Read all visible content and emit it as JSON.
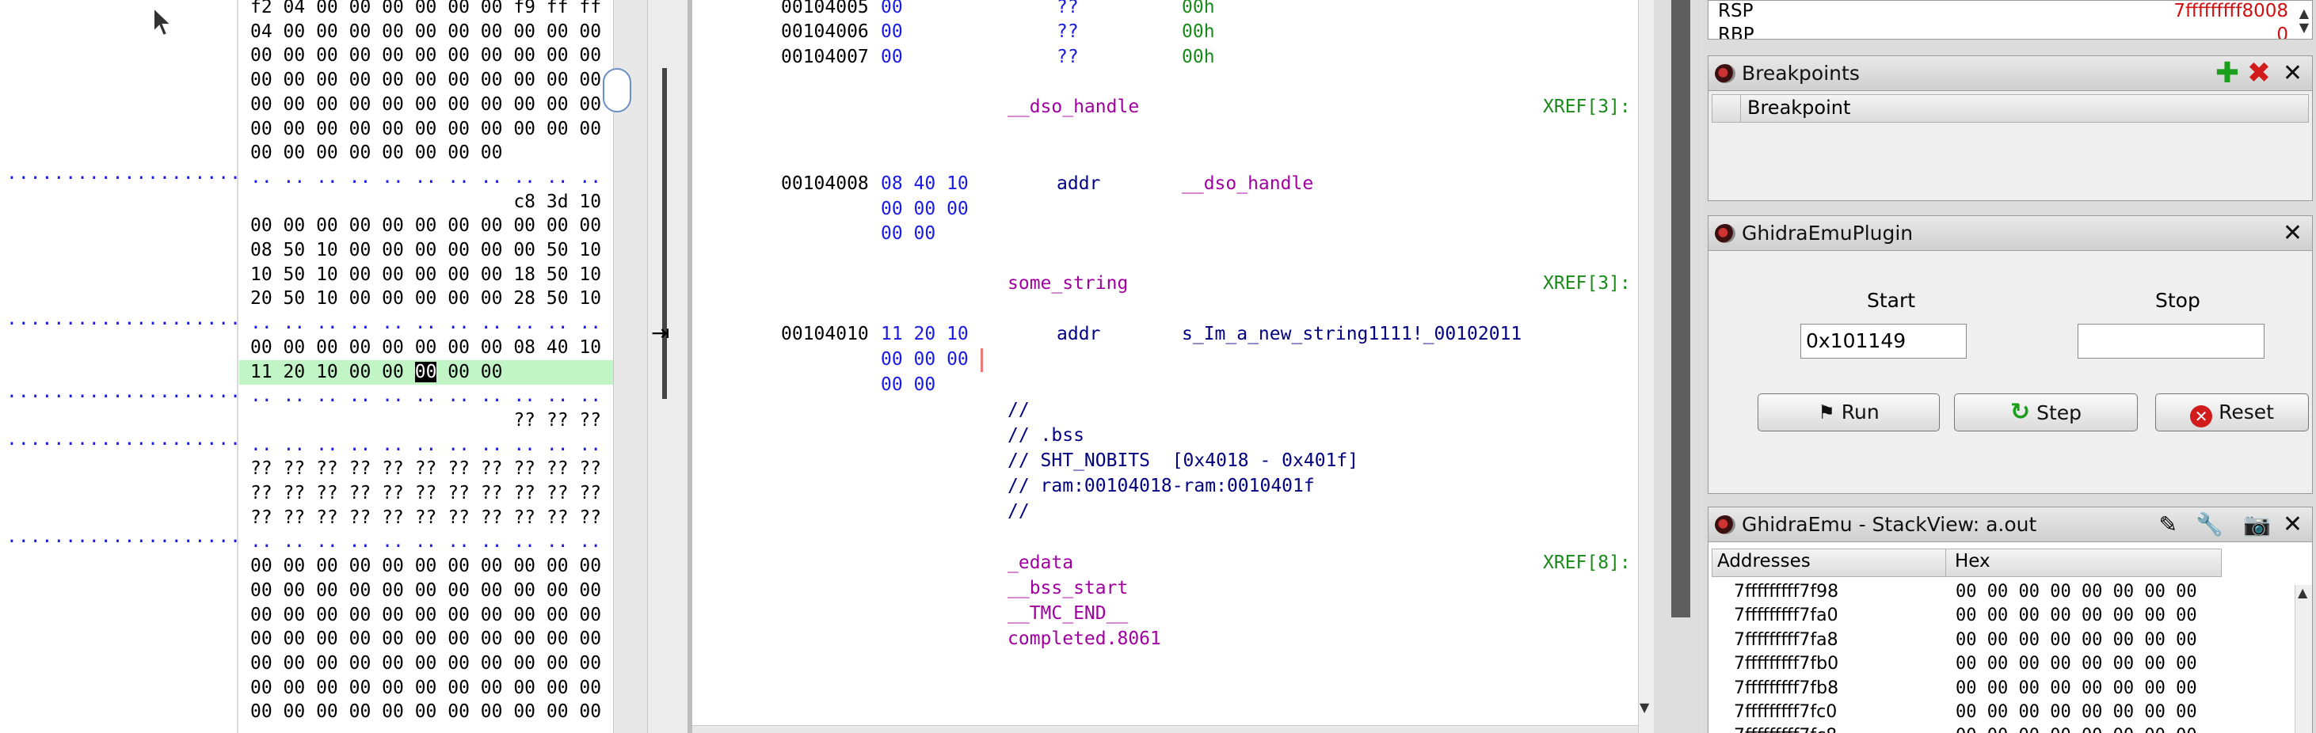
{
  "left_dots": [
    ".....................",
    ".....................",
    ".....................",
    ".....................",
    "....................."
  ],
  "hex_rows": [
    {
      "text": "f2 04 00 00 00 00 00 00 f9 ff ff",
      "kind": "normal"
    },
    {
      "text": "04 00 00 00 00 00 00 00 00 00 00",
      "kind": "normal"
    },
    {
      "text": "00 00 00 00 00 00 00 00 00 00 00",
      "kind": "normal"
    },
    {
      "text": "00 00 00 00 00 00 00 00 00 00 00",
      "kind": "normal"
    },
    {
      "text": "00 00 00 00 00 00 00 00 00 00 00",
      "kind": "normal"
    },
    {
      "text": "00 00 00 00 00 00 00 00 00 00 00",
      "kind": "normal"
    },
    {
      "text": "00 00 00 00 00 00 00 00",
      "kind": "normal"
    },
    {
      "text": ".. .. .. .. .. .. .. .. .. .. ..",
      "kind": "dim"
    },
    {
      "text": "                        c8 3d 10",
      "kind": "normal"
    },
    {
      "text": "00 00 00 00 00 00 00 00 00 00 00",
      "kind": "normal"
    },
    {
      "text": "08 50 10 00 00 00 00 00 00 50 10",
      "kind": "normal"
    },
    {
      "text": "10 50 10 00 00 00 00 00 18 50 10",
      "kind": "normal"
    },
    {
      "text": "20 50 10 00 00 00 00 00 28 50 10",
      "kind": "normal"
    },
    {
      "text": ".. .. .. .. .. .. .. .. .. .. ..",
      "kind": "dim"
    },
    {
      "text": "00 00 00 00 00 00 00 00 08 40 10",
      "kind": "normal"
    },
    {
      "text": "11 20 10 00 00 ",
      "kind": "hl",
      "cursor": "00",
      "after": " 00 00"
    },
    {
      "text": ".. .. .. .. .. .. .. .. .. .. ..",
      "kind": "dim"
    },
    {
      "text": "                        ?? ?? ??",
      "kind": "normal"
    },
    {
      "text": ".. .. .. .. .. .. .. .. .. .. ..",
      "kind": "dim"
    },
    {
      "text": "?? ?? ?? ?? ?? ?? ?? ?? ?? ?? ??",
      "kind": "normal"
    },
    {
      "text": "?? ?? ?? ?? ?? ?? ?? ?? ?? ?? ??",
      "kind": "normal"
    },
    {
      "text": "?? ?? ?? ?? ?? ?? ?? ?? ?? ?? ??",
      "kind": "normal"
    },
    {
      "text": ".. .. .. .. .. .. .. .. .. .. ..",
      "kind": "dim"
    },
    {
      "text": "00 00 00 00 00 00 00 00 00 00 00",
      "kind": "normal"
    },
    {
      "text": "00 00 00 00 00 00 00 00 00 00 00",
      "kind": "normal"
    },
    {
      "text": "00 00 00 00 00 00 00 00 00 00 00",
      "kind": "normal"
    },
    {
      "text": "00 00 00 00 00 00 00 00 00 00 00",
      "kind": "normal"
    },
    {
      "text": "00 00 00 00 00 00 00 00 00 00 00",
      "kind": "normal"
    },
    {
      "text": "00 00 00 00 00 00 00 00 00 00 00",
      "kind": "normal"
    },
    {
      "text": "00 00 00 00 00 00 00 00 00 00 00",
      "kind": "normal"
    }
  ],
  "listing": {
    "rows_top": [
      {
        "addr": "00104005",
        "bytes": "00",
        "mnem": "??",
        "opnd": "00h"
      },
      {
        "addr": "00104006",
        "bytes": "00",
        "mnem": "??",
        "opnd": "00h"
      },
      {
        "addr": "00104007",
        "bytes": "00",
        "mnem": "??",
        "opnd": "00h"
      }
    ],
    "dso_label": "__dso_handle",
    "dso_xref": "XREF[3]:",
    "dso_addr": "00104008",
    "dso_bytes": [
      "08 40 10",
      "00 00 00",
      "00 00"
    ],
    "dso_mnem": "addr",
    "dso_opnd": "__dso_handle",
    "str_label": "some_string",
    "str_xref": "XREF[3]:",
    "str_addr": "00104010",
    "str_bytes": [
      "11 20 10",
      "00 00 00",
      "00 00"
    ],
    "str_mnem": "addr",
    "str_opnd": "s_Im_a_new_string1111!_00102011",
    "comments": [
      "//",
      "// .bss",
      "// SHT_NOBITS  [0x4018 - 0x401f]",
      "// ram:00104018-ram:0010401f",
      "//"
    ],
    "bss_labels": [
      "_edata",
      "__bss_start",
      "__TMC_END__",
      "completed.8061"
    ],
    "bss_xref": "XREF[8]:"
  },
  "registers": {
    "rows": [
      {
        "name": "RSP",
        "value": "7fffffffff8008"
      },
      {
        "name": "RBP",
        "value": "0"
      }
    ]
  },
  "breakpoints": {
    "title": "Breakpoints",
    "column": "Breakpoint"
  },
  "emu_plugin": {
    "title": "GhidraEmuPlugin",
    "start_label": "Start",
    "stop_label": "Stop",
    "start_value": "0x101149",
    "stop_value": "",
    "run_label": "Run",
    "step_label": "Step",
    "reset_label": "Reset"
  },
  "stack_view": {
    "title": "GhidraEmu - StackView: a.out",
    "col_addresses": "Addresses",
    "col_hex": "Hex",
    "rows": [
      {
        "addr": "7fffffffff7f98",
        "hex": "00 00 00 00 00 00 00 00"
      },
      {
        "addr": "7fffffffff7fa0",
        "hex": "00 00 00 00 00 00 00 00"
      },
      {
        "addr": "7fffffffff7fa8",
        "hex": "00 00 00 00 00 00 00 00"
      },
      {
        "addr": "7fffffffff7fb0",
        "hex": "00 00 00 00 00 00 00 00"
      },
      {
        "addr": "7fffffffff7fb8",
        "hex": "00 00 00 00 00 00 00 00"
      },
      {
        "addr": "7fffffffff7fc0",
        "hex": "00 00 00 00 00 00 00 00"
      },
      {
        "addr": "7fffffffff7fc8",
        "hex": "00 00 00 00 00 00 00 00"
      }
    ]
  },
  "colors": {
    "accent_green": "#c2f5c5",
    "label_magenta": "#a100a1",
    "xref_green": "#1a8a1a",
    "bytes_blue": "#1a1ae6",
    "register_red": "#d01010"
  }
}
